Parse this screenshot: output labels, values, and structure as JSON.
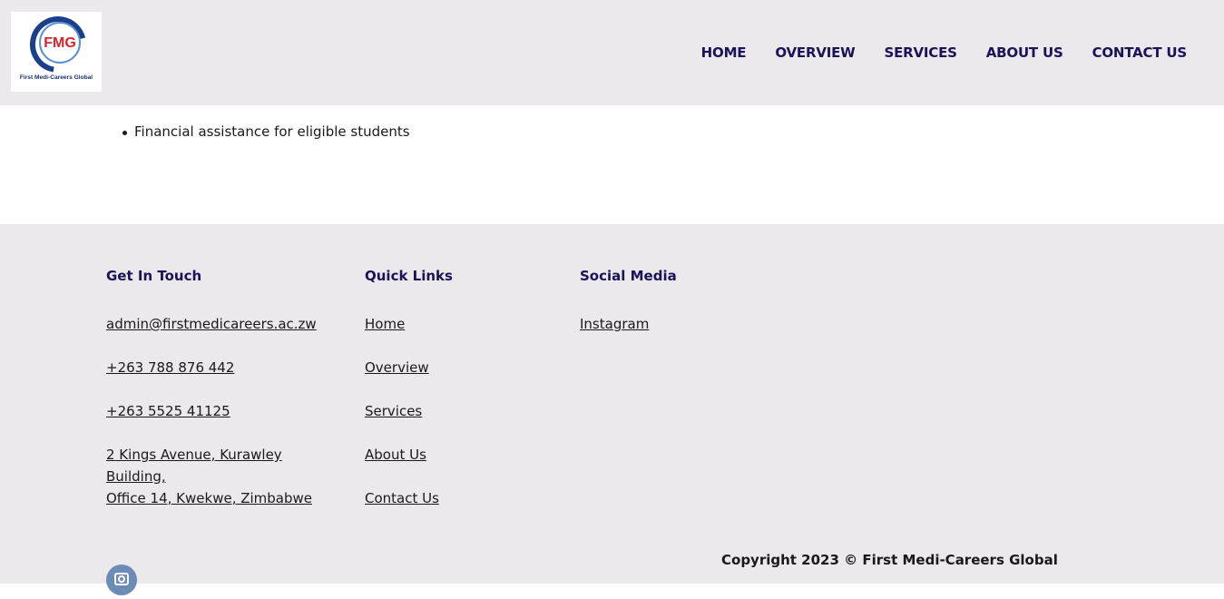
{
  "header": {
    "logo": {
      "abbr": "FMG",
      "name": "First Medi-Careers Global",
      "colors": {
        "ring": "#1c3f8c",
        "text": "#d9232a"
      }
    },
    "nav": [
      "HOME",
      "OVERVIEW",
      "SERVICES",
      "ABOUT US",
      "CONTACT US"
    ]
  },
  "content": {
    "bullets": [
      "Financial assistance for eligible students"
    ]
  },
  "footer": {
    "get_in_touch": {
      "title": "Get In Touch",
      "email": "admin@firstmedicareers.ac.zw",
      "phone1": "+263 788 876 442",
      "phone2": "+263 5525 41125",
      "address_line1": "2 Kings Avenue, Kurawley Building,",
      "address_line2": "Office 14, Kwekwe, Zimbabwe"
    },
    "quick_links": {
      "title": "Quick Links",
      "items": [
        "Home",
        "Overview",
        "Services",
        "About Us",
        "Contact Us"
      ]
    },
    "social_media": {
      "title": "Social Media",
      "items": [
        "Instagram"
      ]
    },
    "copyright": "Copyright 2023 © First Medi-Careers Global",
    "social_icon": "instagram-icon"
  },
  "colors": {
    "header_bg": "#ebe9eb",
    "nav_text": "#1b1257",
    "footer_bg": "#ebe9eb"
  }
}
